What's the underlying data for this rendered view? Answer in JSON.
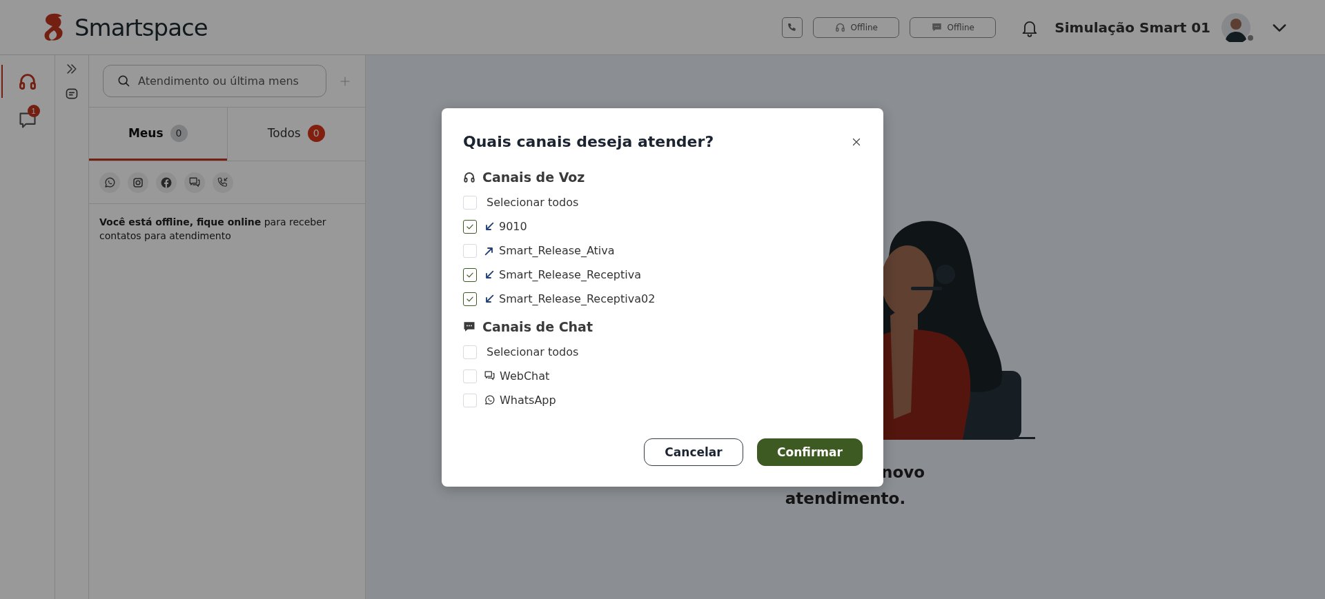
{
  "header": {
    "logo": "Smartspace",
    "status_buttons": [
      {
        "kind": "voice",
        "label": "Offline"
      },
      {
        "kind": "chat",
        "label": "Offline"
      }
    ],
    "user_name": "Simulação Smart 01"
  },
  "rail": {
    "items": [
      {
        "kind": "headset",
        "selected": true
      },
      {
        "kind": "chat",
        "selected": false,
        "badge": "1"
      }
    ]
  },
  "search": {
    "placeholder": "Atendimento ou última mens"
  },
  "tabs": [
    {
      "label": "Meus",
      "count": "0",
      "selected": true
    },
    {
      "label": "Todos",
      "count": "0",
      "selected": false
    }
  ],
  "notice": "**Você está offline, fique online** para receber contatos para atendimento",
  "empty_state": {
    "lines": [
      "novo",
      "atendimento."
    ]
  },
  "modal": {
    "title": "Quais canais deseja atender?",
    "sections": [
      {
        "kind": "voice",
        "heading": "Canais de Voz",
        "select_all": {
          "label": "Selecionar todos",
          "checked": false
        },
        "channels": [
          {
            "kind": "inbound",
            "name": "9010",
            "checked": true
          },
          {
            "kind": "outbound",
            "name": "Smart_Release_Ativa",
            "checked": false
          },
          {
            "kind": "inbound",
            "name": "Smart_Release_Receptiva",
            "checked": true
          },
          {
            "kind": "inbound",
            "name": "Smart_Release_Receptiva02",
            "checked": true
          }
        ]
      },
      {
        "kind": "chat",
        "heading": "Canais de Chat",
        "select_all": {
          "label": "Selecionar todos",
          "checked": false
        },
        "channels": [
          {
            "kind": "webchat",
            "name": "WebChat",
            "checked": false
          },
          {
            "kind": "whatsapp",
            "name": "WhatsApp",
            "checked": false
          }
        ]
      }
    ],
    "buttons": [
      {
        "kind": "secondary",
        "label": "Cancelar"
      },
      {
        "kind": "primary",
        "label": "Confirmar"
      }
    ]
  }
}
